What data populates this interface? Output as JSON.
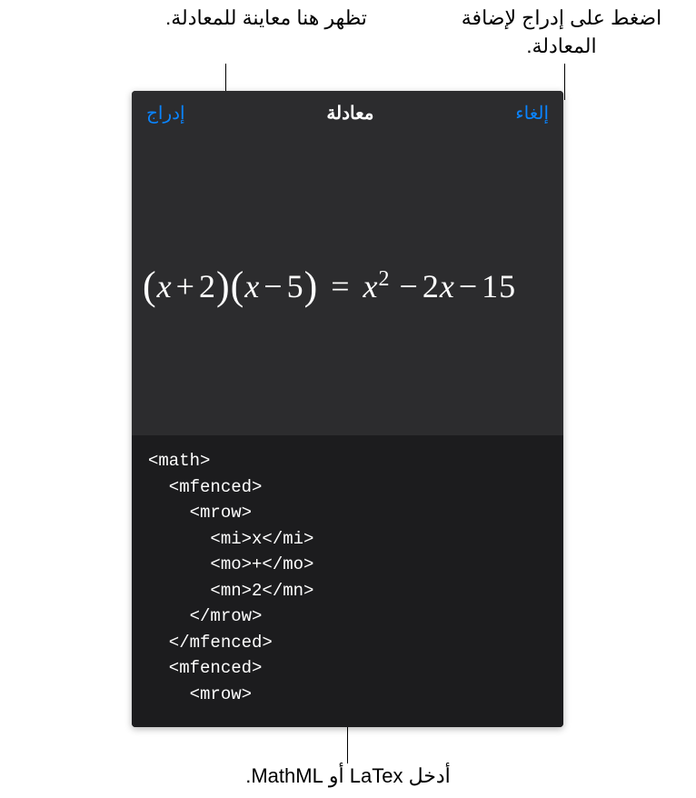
{
  "callouts": {
    "insert_hint": "اضغط على إدراج لإضافة المعادلة.",
    "preview_hint": "تظهر هنا معاينة للمعادلة.",
    "input_hint": "أدخل LaTex أو MathML."
  },
  "dialog": {
    "title": "معادلة",
    "cancel_label": "إلغاء",
    "insert_label": "إدراج"
  },
  "equation": {
    "rendered_parts": {
      "lp1": "(",
      "x1": "x",
      "plus": "+",
      "n2": "2",
      "rp1": ")",
      "lp2": "(",
      "x2": "x",
      "minus1": "−",
      "n5": "5",
      "rp2": ")",
      "eq": "=",
      "x3": "x",
      "sup2": "2",
      "minus2": "−",
      "coef2": "2",
      "x4": "x",
      "minus3": "−",
      "n15": "15"
    },
    "source_code": "<math>\n  <mfenced>\n    <mrow>\n      <mi>x</mi>\n      <mo>+</mo>\n      <mn>2</mn>\n    </mrow>\n  </mfenced>\n  <mfenced>\n    <mrow>"
  }
}
